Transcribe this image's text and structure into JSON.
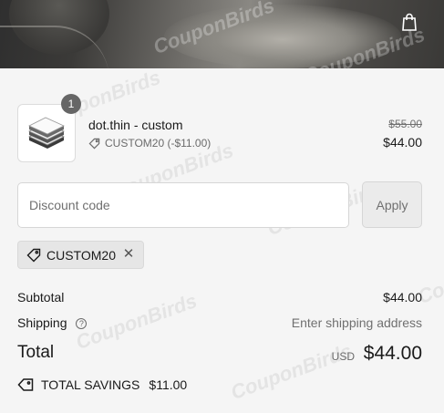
{
  "header": {
    "cart_icon": "shopping-bag-icon"
  },
  "cart_item": {
    "quantity_badge": "1",
    "name": "dot.thin - custom",
    "discount_label": "CUSTOM20 (-$11.00)",
    "original_price": "$55.00",
    "final_price": "$44.00",
    "thumbnail_icon": "product-image"
  },
  "discount": {
    "placeholder": "Discount code",
    "apply_label": "Apply",
    "applied_code": "CUSTOM20",
    "remove_icon": "close-icon"
  },
  "summary": {
    "subtotal_label": "Subtotal",
    "subtotal_value": "$44.00",
    "shipping_label": "Shipping",
    "shipping_help_icon": "question-icon",
    "shipping_value": "Enter shipping address",
    "total_label": "Total",
    "total_currency": "USD",
    "total_value": "$44.00",
    "savings_label": "TOTAL SAVINGS",
    "savings_value": "$11.00"
  },
  "watermark": "CouponBirds",
  "colors": {
    "background": "#f5f5f5",
    "badge": "#666666",
    "muted_text": "#707070"
  }
}
